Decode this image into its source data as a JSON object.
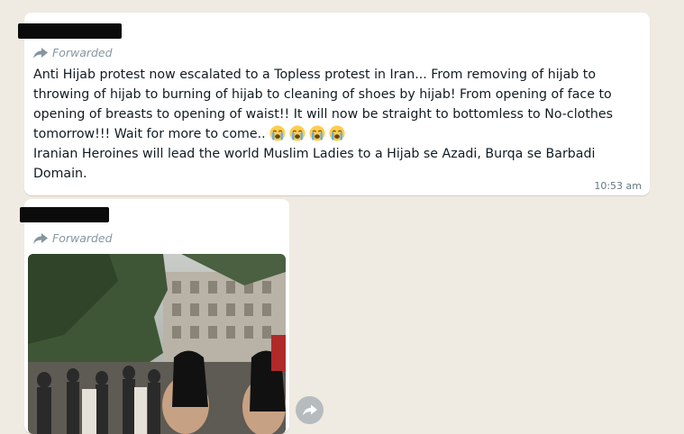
{
  "messages": [
    {
      "forwarded_label": "Forwarded",
      "paragraphs": [
        "Anti Hijab protest now escalated to a Topless protest in Iran... From removing of hijab to throwing of hijab to burning of hijab to cleaning of shoes by hijab! From opening of face to opening of breasts to opening of waist!! It will now be straight to bottomless to No-clothes tomorrow!!! Wait for more to come..",
        "Iranian Heroines will lead the world Muslim Ladies to a Hijab se Azadi, Burqa se Barbadi Domain."
      ],
      "emojis": [
        "loudly-crying-face-icon",
        "loudly-crying-face-icon",
        "loudly-crying-face-icon",
        "loudly-crying-face-icon"
      ],
      "time": "10:53 am"
    },
    {
      "forwarded_label": "Forwarded",
      "media": "photo"
    }
  ],
  "colors": {
    "background": "#efeae2",
    "bubble": "#ffffff",
    "meta_text": "#8696a0",
    "redaction": "#0b0b0b"
  }
}
